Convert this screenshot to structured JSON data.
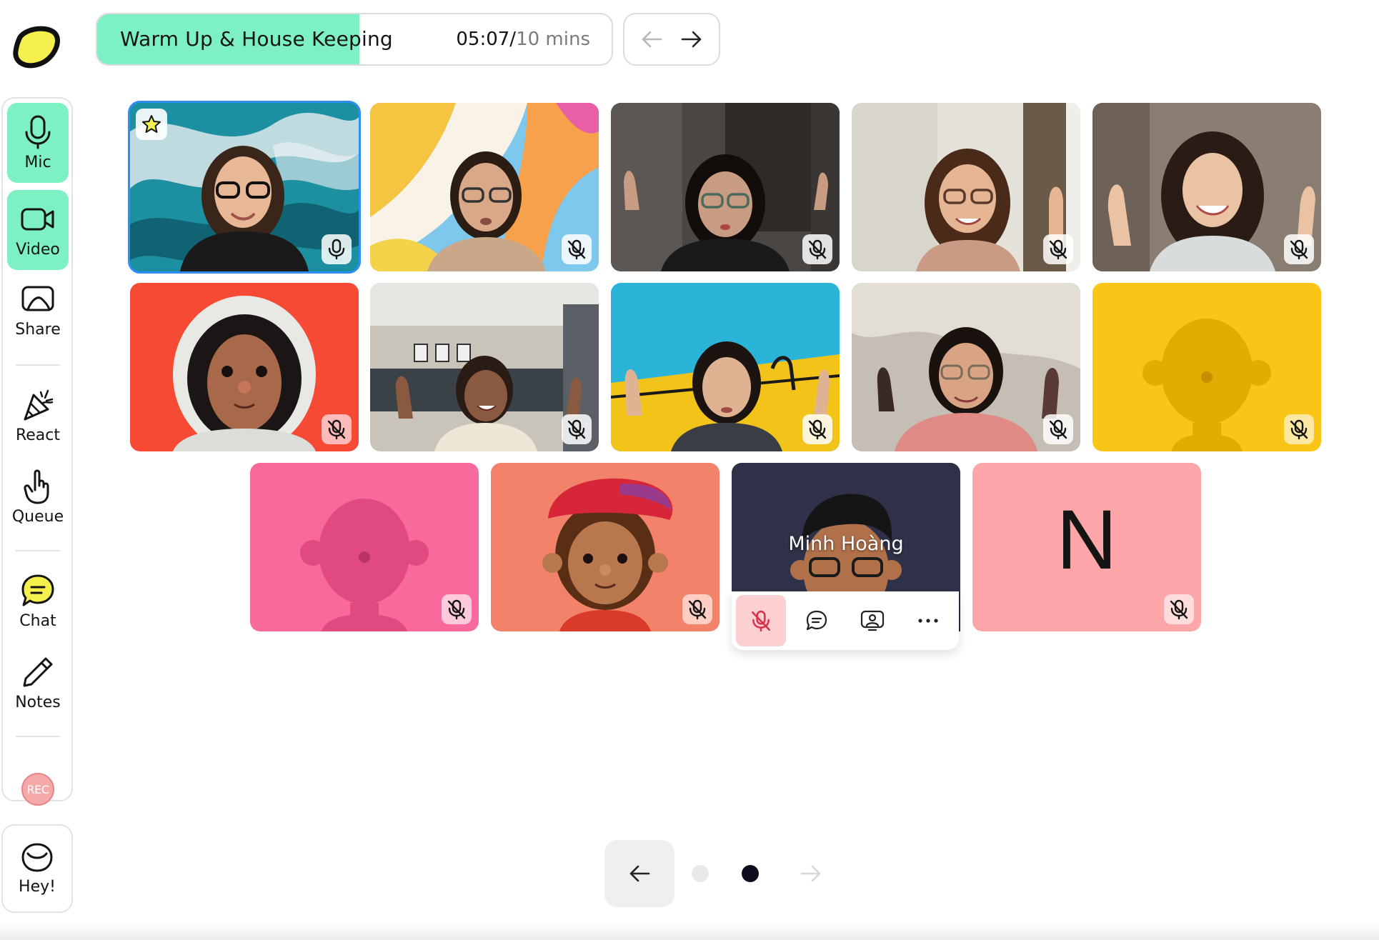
{
  "agenda": {
    "title": "Warm Up & House Keeping",
    "elapsed": "05:07",
    "separator": "/",
    "total": "10 mins",
    "progress_fraction": 0.51
  },
  "toolbar": {
    "mic": "Mic",
    "video": "Video",
    "share": "Share",
    "react": "React",
    "queue": "Queue",
    "chat": "Chat",
    "notes": "Notes",
    "rec": "REC"
  },
  "hey": {
    "label": "Hey!"
  },
  "tiles": {
    "t13": {
      "name": "Minh Hoàng"
    },
    "t14": {
      "initial": "N"
    }
  },
  "colors": {
    "accent": "#7df0c4",
    "speaking_outline": "#2f8ef5",
    "mute_badge": "#fcd0d0",
    "logo_yellow": "#f6f04f"
  },
  "pagination": {
    "current_page": 2,
    "total_pages": 2
  }
}
